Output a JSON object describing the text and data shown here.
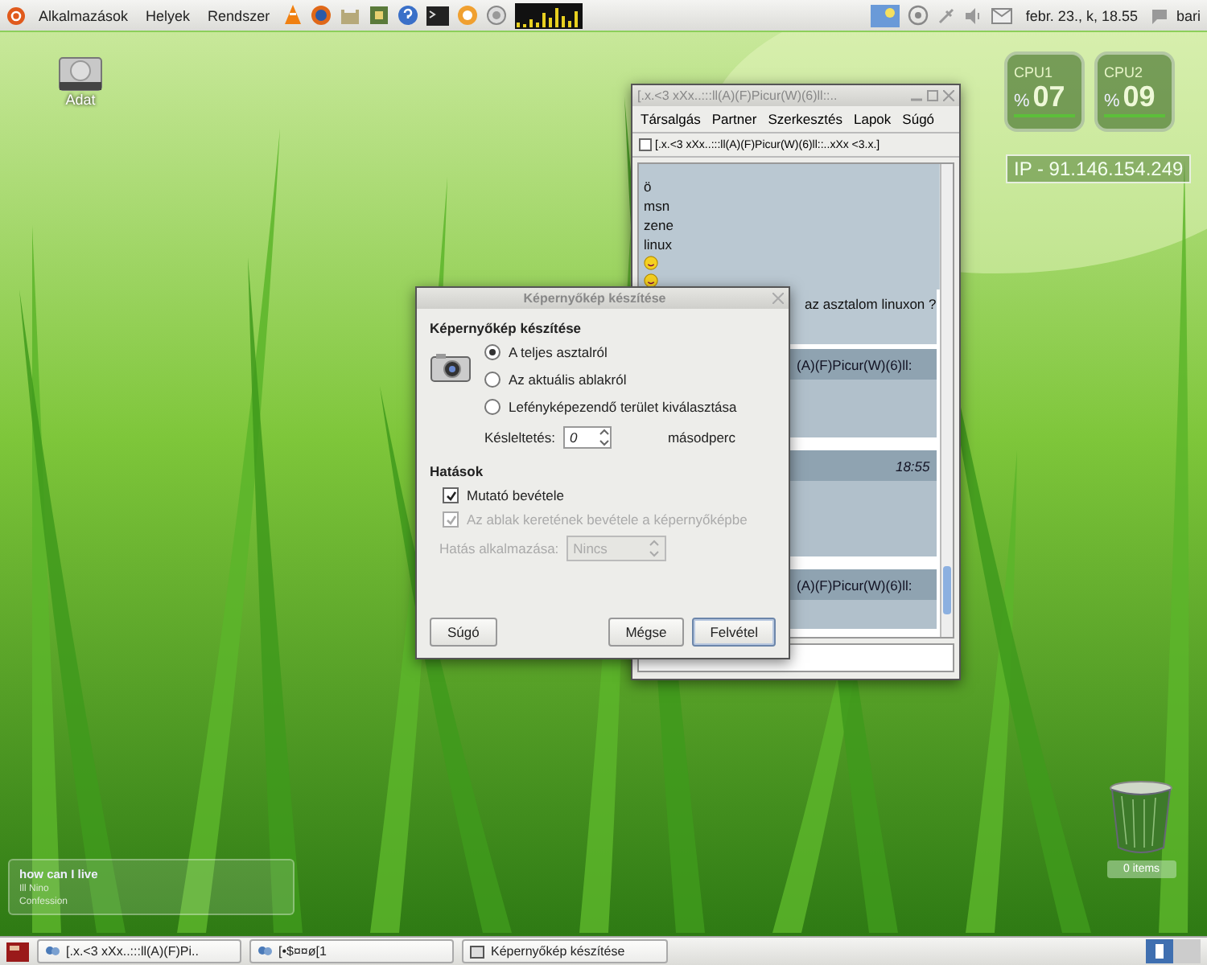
{
  "top_panel": {
    "menus": [
      "Alkalmazások",
      "Helyek",
      "Rendszer"
    ],
    "clock": "febr. 23., k, 18.55",
    "user": "bari"
  },
  "desktop_icons": [
    {
      "label": "Adat"
    }
  ],
  "cpu_meters": [
    {
      "label": "CPU1",
      "unit": "%",
      "value": "07"
    },
    {
      "label": "CPU2",
      "unit": "%",
      "value": "09"
    }
  ],
  "ip_display": "IP - 91.146.154.249",
  "chat_window": {
    "title": "[.x.<3 xXx..:::ll(A)(F)Picur(W)(6)ll::..",
    "menus": [
      "Társalgás",
      "Partner",
      "Szerkesztés",
      "Lapok",
      "Súgó"
    ],
    "tab": "[.x.<3 xXx..:::ll(A)(F)Picur(W)(6)ll::..xXx <3.x.]",
    "messages": [
      {
        "kind": "text",
        "text": "ö"
      },
      {
        "kind": "text",
        "text": "msn"
      },
      {
        "kind": "text",
        "text": "zene"
      },
      {
        "kind": "text",
        "text": "linux"
      },
      {
        "kind": "smiley"
      },
      {
        "kind": "smiley"
      },
      {
        "kind": "partial",
        "text": "az asztalom linuxon ?"
      },
      {
        "kind": "header",
        "text": "(A)(F)Picur(W)(6)ll:"
      },
      {
        "kind": "body"
      },
      {
        "kind": "header",
        "time": "18:55"
      },
      {
        "kind": "body"
      },
      {
        "kind": "header",
        "text": "(A)(F)Picur(W)(6)ll:"
      },
      {
        "kind": "body"
      }
    ]
  },
  "dialog": {
    "title": "Képernyőkép készítése",
    "heading": "Képernyőkép készítése",
    "options": [
      {
        "label": "A teljes asztalról",
        "selected": true
      },
      {
        "label": "Az aktuális ablakról",
        "selected": false
      },
      {
        "label": "Lefényképezendő terület kiválasztása",
        "selected": false
      }
    ],
    "delay_label": "Késleltetés:",
    "delay_value": "0",
    "delay_unit": "másodperc",
    "effects_heading": "Hatások",
    "checkboxes": [
      {
        "label": "Mutató bevétele",
        "checked": true,
        "disabled": false
      },
      {
        "label": "Az ablak keretének bevétele a képernyőképbe",
        "checked": true,
        "disabled": true
      }
    ],
    "effect_label": "Hatás alkalmazása:",
    "effect_value": "Nincs",
    "effect_disabled": true,
    "buttons": [
      {
        "label": "Súgó",
        "kind": "help"
      },
      {
        "label": "Mégse",
        "kind": "normal"
      },
      {
        "label": "Felvétel",
        "kind": "default"
      }
    ]
  },
  "music_widget": {
    "title": "how can I live",
    "artist": "Ill Nino",
    "album": "Confession"
  },
  "trash": {
    "label": "0 items"
  },
  "taskbar": [
    {
      "label": "[.x.<3 xXx..:::ll(A)(F)Pi..",
      "kind": "chat"
    },
    {
      "label": "[•$¤¤ø[1",
      "kind": "chat"
    },
    {
      "label": "Képernyőkép készítése",
      "kind": "screenshot"
    }
  ]
}
